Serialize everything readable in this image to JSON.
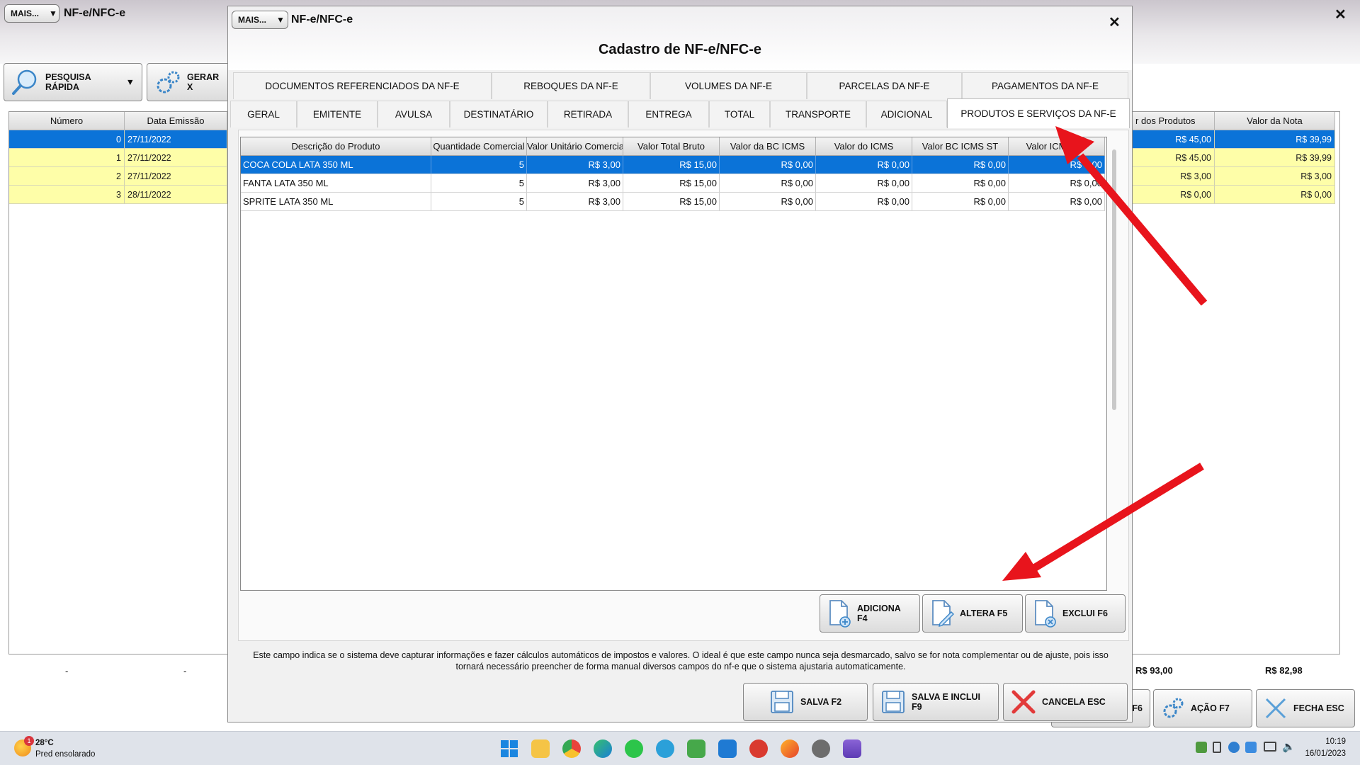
{
  "main_window": {
    "mais_label": "MAIS...",
    "title": "NF-e/NFC-e",
    "close_glyph": "✕",
    "toolbar": {
      "quick_search": "PESQUISA RÁPIDA",
      "gerar": "GERAR X"
    },
    "grid_headers": [
      "Número",
      "Data Emissão",
      "r dos Produtos",
      "Valor da Nota"
    ],
    "rows": [
      {
        "numero": "0",
        "data": "27/11/2022",
        "produtos": "R$ 45,00",
        "nota": "R$ 39,99"
      },
      {
        "numero": "1",
        "data": "27/11/2022",
        "produtos": "R$ 45,00",
        "nota": "R$ 39,99"
      },
      {
        "numero": "2",
        "data": "27/11/2022",
        "produtos": "R$ 3,00",
        "nota": "R$ 3,00"
      },
      {
        "numero": "3",
        "data": "28/11/2022",
        "produtos": "R$ 0,00",
        "nota": "R$ 0,00"
      }
    ],
    "footer": {
      "dash1": "-",
      "dash2": "-",
      "total_produtos": "R$ 93,00",
      "total_nota": "R$ 82,98"
    },
    "bottom_buttons": {
      "f6_partial": "F6",
      "acao": "AÇÃO F7",
      "fecha": "FECHA ESC"
    }
  },
  "modal": {
    "mais_label": "MAIS...",
    "window_title": "NF-e/NFC-e",
    "close_glyph": "✕",
    "heading": "Cadastro de NF-e/NFC-e",
    "tabs_row1": [
      "DOCUMENTOS REFERENCIADOS DA NF-E",
      "REBOQUES DA NF-E",
      "VOLUMES DA NF-E",
      "PARCELAS DA NF-E",
      "PAGAMENTOS DA NF-E"
    ],
    "tabs_row2": [
      "GERAL",
      "EMITENTE",
      "AVULSA",
      "DESTINATÁRIO",
      "RETIRADA",
      "ENTREGA",
      "TOTAL",
      "TRANSPORTE",
      "ADICIONAL",
      "PRODUTOS E SERVIÇOS DA NF-E"
    ],
    "active_tab": "PRODUTOS E SERVIÇOS DA NF-E",
    "grid_headers": [
      "Descrição do Produto",
      "Quantidade Comercial",
      "Valor Unitário Comercial",
      "Valor Total Bruto",
      "Valor da BC ICMS",
      "Valor do ICMS",
      "Valor BC ICMS ST",
      "Valor ICMS ST"
    ],
    "products": [
      {
        "descricao": "COCA COLA LATA 350 ML",
        "qtd": "5",
        "unit": "R$ 3,00",
        "bruto": "R$ 15,00",
        "bc_icms": "R$ 0,00",
        "icms": "R$ 0,00",
        "bc_st": "R$ 0,00",
        "icms_st": "R$ 0,00"
      },
      {
        "descricao": "FANTA LATA 350 ML",
        "qtd": "5",
        "unit": "R$ 3,00",
        "bruto": "R$ 15,00",
        "bc_icms": "R$ 0,00",
        "icms": "R$ 0,00",
        "bc_st": "R$ 0,00",
        "icms_st": "R$ 0,00"
      },
      {
        "descricao": "SPRITE LATA 350 ML",
        "qtd": "5",
        "unit": "R$ 3,00",
        "bruto": "R$ 15,00",
        "bc_icms": "R$ 0,00",
        "icms": "R$ 0,00",
        "bc_st": "R$ 0,00",
        "icms_st": "R$ 0,00"
      }
    ],
    "actions": {
      "adiciona": "ADICIONA F4",
      "altera": "ALTERA F5",
      "exclui": "EXCLUI F6"
    },
    "info_line1": "Este campo indica se o sistema deve capturar informações e fazer cálculos automáticos de impostos e valores. O ideal é que este campo nunca seja desmarcado, salvo se for nota complementar ou de ajuste, pois isso",
    "info_line2": "tornará necessário preencher de forma manual diversos campos do nf-e que o sistema ajustaria automaticamente.",
    "footer": {
      "salva": "SALVA F2",
      "salva_inclui": "SALVA E INCLUI F9",
      "cancela": "CANCELA ESC"
    }
  },
  "annotation_color": "#e8141c",
  "taskbar": {
    "weather_temp": "28°C",
    "weather_desc": "Pred ensolarado",
    "weather_badge": "1",
    "time": "10:19",
    "date": "16/01/2023",
    "apps": [
      "start-icon",
      "file-explorer-icon",
      "chrome-icon",
      "edge-icon",
      "whatsapp-icon",
      "telegram-icon",
      "notepad-icon",
      "mail-icon",
      "app-icon",
      "firefox-icon",
      "gear-app-icon",
      "media-icon"
    ]
  }
}
